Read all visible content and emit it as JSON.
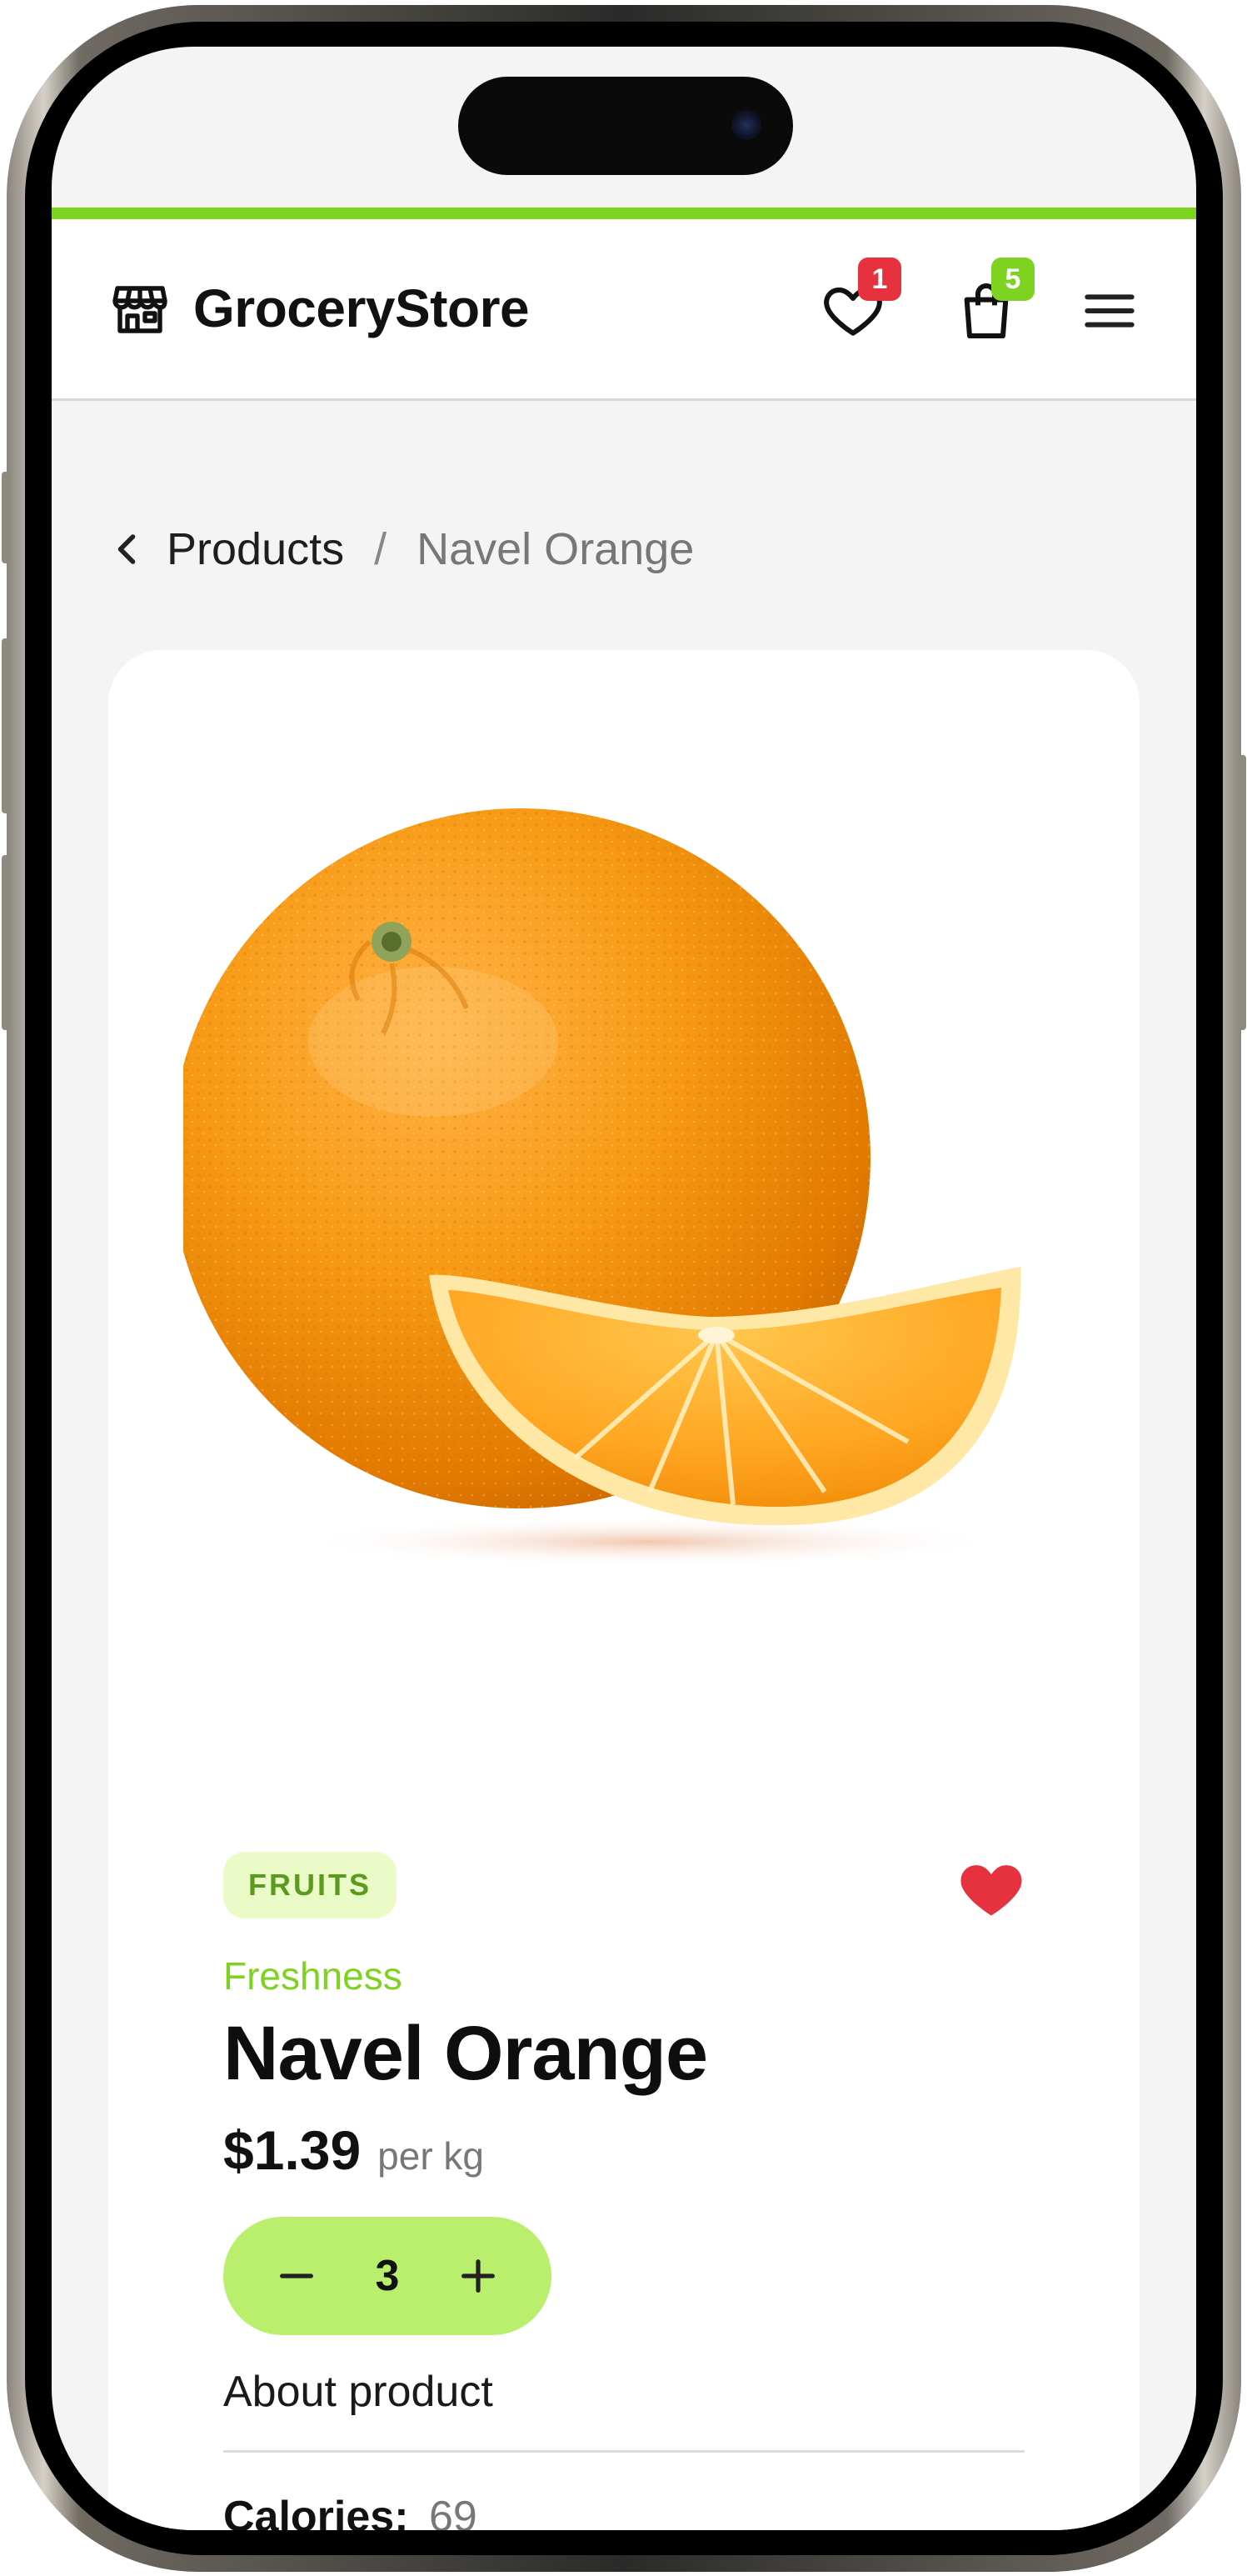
{
  "header": {
    "brand": "GroceryStore",
    "wishlist_count": "1",
    "cart_count": "5"
  },
  "breadcrumb": {
    "parent": "Products",
    "separator": "/",
    "current": "Navel Orange"
  },
  "product": {
    "category": "FRUITS",
    "subtitle": "Freshness",
    "name": "Navel Orange",
    "price": "$1.39",
    "unit": "per kg",
    "quantity": "3",
    "about_label": "About product",
    "nutrition": {
      "calories_label": "Calories:",
      "calories_value": "69"
    },
    "favorited": true
  },
  "colors": {
    "accent": "#7ed321",
    "stepper": "#b9ef6c",
    "badge_red": "#e5323e",
    "heart": "#e5323e"
  },
  "icons": {
    "logo": "storefront-icon",
    "wishlist": "heart-outline-icon",
    "cart": "shopping-bag-icon",
    "menu": "hamburger-menu-icon",
    "back": "chevron-left-icon",
    "favorite": "heart-filled-icon",
    "decrement": "minus-icon",
    "increment": "plus-icon"
  }
}
